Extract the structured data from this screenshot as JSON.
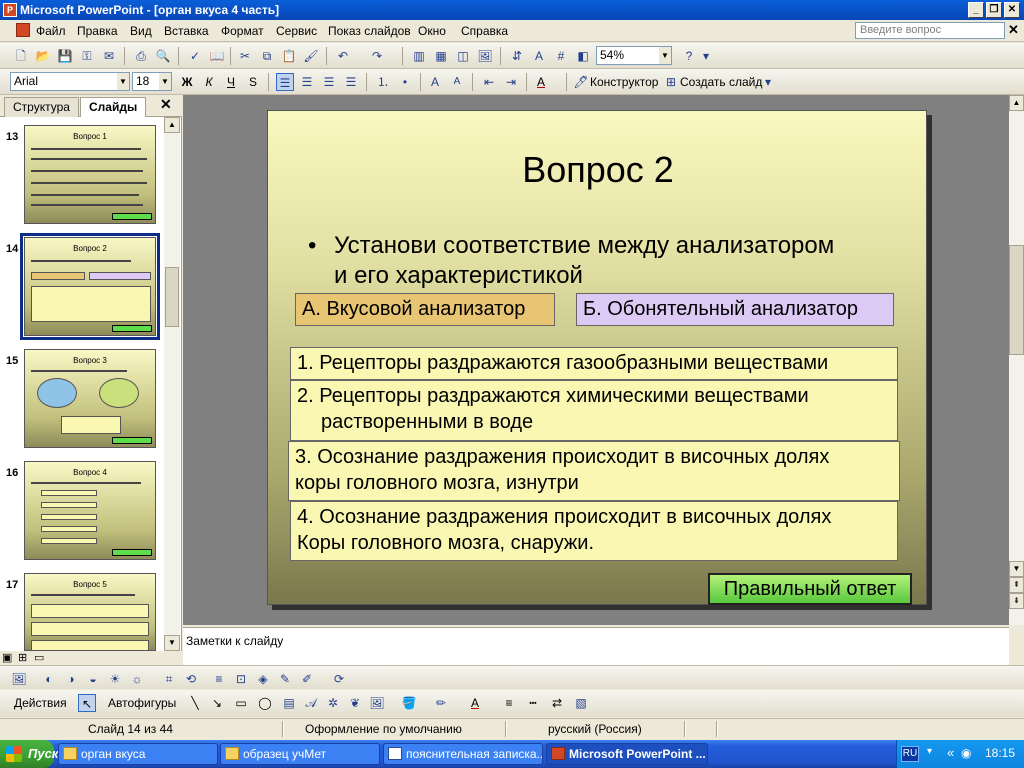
{
  "window": {
    "title": "Microsoft PowerPoint - [орган вкуса 4 часть]"
  },
  "menu": {
    "items": [
      "Файл",
      "Правка",
      "Вид",
      "Вставка",
      "Формат",
      "Сервис",
      "Показ слайдов",
      "Окно",
      "Справка"
    ],
    "help_placeholder": "Введите вопрос"
  },
  "toolbar": {
    "zoom": "54%"
  },
  "format_toolbar": {
    "font": "Arial",
    "size": "18",
    "bold": "Ж",
    "italic": "К",
    "underline": "Ч",
    "shadow": "S",
    "design_label": "Конструктор",
    "new_slide_label": "Создать слайд"
  },
  "pane": {
    "tabs": [
      "Структура",
      "Слайды"
    ],
    "thumbnails": [
      {
        "number": "13",
        "title": "Вопрос 1"
      },
      {
        "number": "14",
        "title": "Вопрос 2"
      },
      {
        "number": "15",
        "title": "Вопрос 3"
      },
      {
        "number": "16",
        "title": "Вопрос 4"
      },
      {
        "number": "17",
        "title": "Вопрос 5"
      }
    ]
  },
  "slide": {
    "title": "Вопрос 2",
    "bullet_line1": "Установи соответствие между анализатором",
    "bullet_line2": "и его характеристикой",
    "analyzer_a": "А. Вкусовой анализатор",
    "analyzer_b": "Б. Обонятельный анализатор",
    "options": [
      {
        "line1": "1.  Рецепторы раздражаются газообразными веществами",
        "line2": ""
      },
      {
        "line1": "2. Рецепторы раздражаются химическими  веществами",
        "line2": "растворенными в воде"
      },
      {
        "line1": "3.  Осознание раздражения происходит в височных долях",
        "line2": "коры головного мозга, изнутри"
      },
      {
        "line1": "4.  Осознание раздражения происходит в височных долях",
        "line2": "Коры головного мозга, снаружи."
      }
    ],
    "correct_answer": "Правильный ответ",
    "colors": {
      "analyzer_a": "#e8c573",
      "analyzer_b": "#dcc9f4",
      "correct": "#58c83c"
    }
  },
  "notes": {
    "placeholder": "Заметки к слайду"
  },
  "drawing": {
    "actions": "Действия",
    "autoshapes": "Автофигуры"
  },
  "status": {
    "slide": "Слайд 14 из 44",
    "design": "Оформление по умолчанию",
    "language": "русский (Россия)"
  },
  "taskbar": {
    "start": "Пуск",
    "tasks": [
      "орган вкуса",
      "образец учМет",
      "пояснительная записка...",
      "Microsoft PowerPoint ..."
    ],
    "lang": "RU",
    "time": "18:15"
  }
}
